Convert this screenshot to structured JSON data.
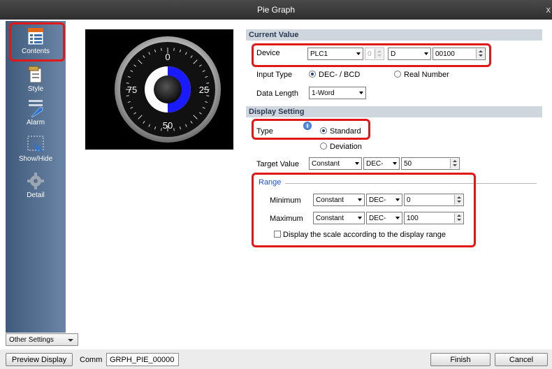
{
  "window": {
    "title": "Pie Graph",
    "close_label": "x"
  },
  "sidebar": {
    "items": [
      {
        "label": "Contents",
        "icon": "contents-icon"
      },
      {
        "label": "Style",
        "icon": "style-icon"
      },
      {
        "label": "Alarm",
        "icon": "alarm-icon"
      },
      {
        "label": "Show/Hide",
        "icon": "show-hide-icon"
      },
      {
        "label": "Detail",
        "icon": "gear-icon"
      }
    ],
    "other_settings": "Other Settings"
  },
  "preview": {
    "tick_labels": {
      "top": "0",
      "left": "75",
      "right": "25",
      "bottom": "50"
    },
    "fill_fraction": 0.5,
    "colors": {
      "fill": "#1a1aff",
      "track": "#ffffff",
      "background": "#000000"
    }
  },
  "current_value": {
    "header": "Current Value",
    "device_label": "Device",
    "device_plc": "PLC1",
    "device_station": "0",
    "device_type": "D",
    "device_address": "00100",
    "input_type_label": "Input Type",
    "input_type_options": [
      "DEC- / BCD",
      "Real Number"
    ],
    "data_length_label": "Data Length",
    "data_length": "1-Word"
  },
  "display_setting": {
    "header": "Display Setting",
    "type_label": "Type",
    "type_options": [
      "Standard",
      "Deviation"
    ],
    "target_value_label": "Target Value",
    "target_source": "Constant",
    "target_format": "DEC-",
    "target_value": "50"
  },
  "range": {
    "title": "Range",
    "minimum_label": "Minimum",
    "minimum_source": "Constant",
    "minimum_format": "DEC-",
    "minimum_value": "0",
    "maximum_label": "Maximum",
    "maximum_source": "Constant",
    "maximum_format": "DEC-",
    "maximum_value": "100",
    "scale_checkbox": "Display the scale according to the display range"
  },
  "footer": {
    "preview_button": "Preview Display",
    "comm_label": "Comm",
    "comm_value": "GRPH_PIE_00000",
    "finish_button": "Finish",
    "cancel_button": "Cancel"
  },
  "colors": {
    "highlight": "#e01818",
    "section_header": "#d0d6de",
    "sidebar": "#4f6b8d"
  }
}
